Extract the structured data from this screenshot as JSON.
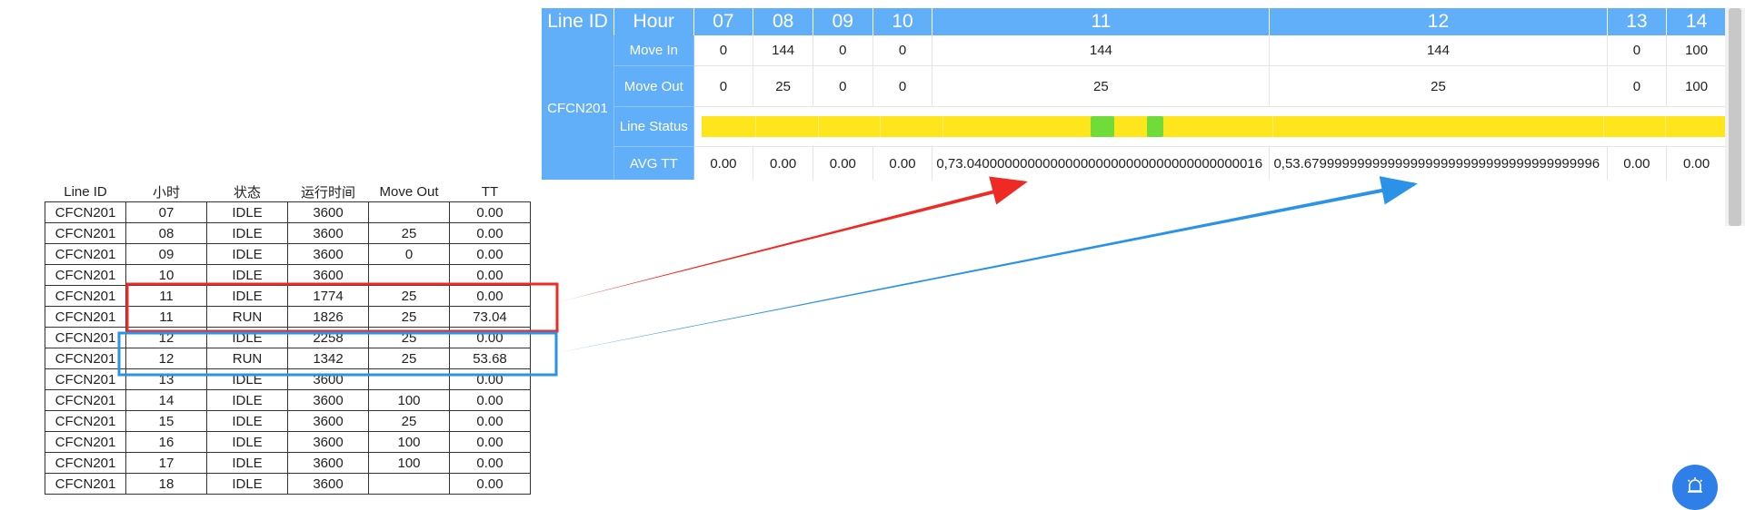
{
  "dashboard": {
    "header": {
      "line_id": "Line ID",
      "hour": "Hour",
      "hours": [
        "07",
        "08",
        "09",
        "10",
        "11",
        "12",
        "13",
        "14"
      ]
    },
    "line_id": "CFCN201",
    "rows": {
      "move_in": {
        "label": "Move In",
        "values": [
          "0",
          "144",
          "0",
          "0",
          "144",
          "144",
          "0",
          "100"
        ]
      },
      "move_out": {
        "label": "Move Out",
        "values": [
          "0",
          "25",
          "0",
          "0",
          "25",
          "25",
          "0",
          "100"
        ]
      },
      "line_status": {
        "label": "Line Status",
        "running_segments": [
          {
            "hour": "11",
            "start_fraction": 0.45,
            "end_fraction": 0.52
          },
          {
            "hour": "11",
            "start_fraction": 0.62,
            "end_fraction": 0.67
          }
        ],
        "colors": {
          "idle": "#ffe51c",
          "run": "#70dc3a"
        }
      },
      "avg_tt": {
        "label": "AVG TT",
        "values": [
          "0.00",
          "0.00",
          "0.00",
          "0.00",
          "0,73.040000000000000000000000000000000000016",
          "0,53.679999999999999999999999999999999999996",
          "0.00",
          "0.00"
        ]
      }
    },
    "header_color": "#61aef9"
  },
  "raw_table": {
    "headers": [
      "Line ID",
      "小时",
      "状态",
      "运行时间",
      "Move Out",
      "TT"
    ],
    "rows": [
      [
        "CFCN201",
        "07",
        "IDLE",
        "3600",
        "",
        "0.00"
      ],
      [
        "CFCN201",
        "08",
        "IDLE",
        "3600",
        "25",
        "0.00"
      ],
      [
        "CFCN201",
        "09",
        "IDLE",
        "3600",
        "0",
        "0.00"
      ],
      [
        "CFCN201",
        "10",
        "IDLE",
        "3600",
        "",
        "0.00"
      ],
      [
        "CFCN201",
        "11",
        "IDLE",
        "1774",
        "25",
        "0.00"
      ],
      [
        "CFCN201",
        "11",
        "RUN",
        "1826",
        "25",
        "73.04"
      ],
      [
        "CFCN201",
        "12",
        "IDLE",
        "2258",
        "25",
        "0.00"
      ],
      [
        "CFCN201",
        "12",
        "RUN",
        "1342",
        "25",
        "53.68"
      ],
      [
        "CFCN201",
        "13",
        "IDLE",
        "3600",
        "",
        "0.00"
      ],
      [
        "CFCN201",
        "14",
        "IDLE",
        "3600",
        "100",
        "0.00"
      ],
      [
        "CFCN201",
        "15",
        "IDLE",
        "3600",
        "25",
        "0.00"
      ],
      [
        "CFCN201",
        "16",
        "IDLE",
        "3600",
        "100",
        "0.00"
      ],
      [
        "CFCN201",
        "17",
        "IDLE",
        "3600",
        "100",
        "0.00"
      ],
      [
        "CFCN201",
        "18",
        "IDLE",
        "3600",
        "",
        "0.00"
      ]
    ]
  },
  "annotations": {
    "red_highlight": {
      "rows": [
        "11"
      ],
      "color": "#ee2a24"
    },
    "blue_highlight": {
      "rows": [
        "12"
      ],
      "color": "#2a93e8"
    }
  },
  "floating_button": {
    "icon": "alarm-icon",
    "color": "#2f7fe8"
  }
}
